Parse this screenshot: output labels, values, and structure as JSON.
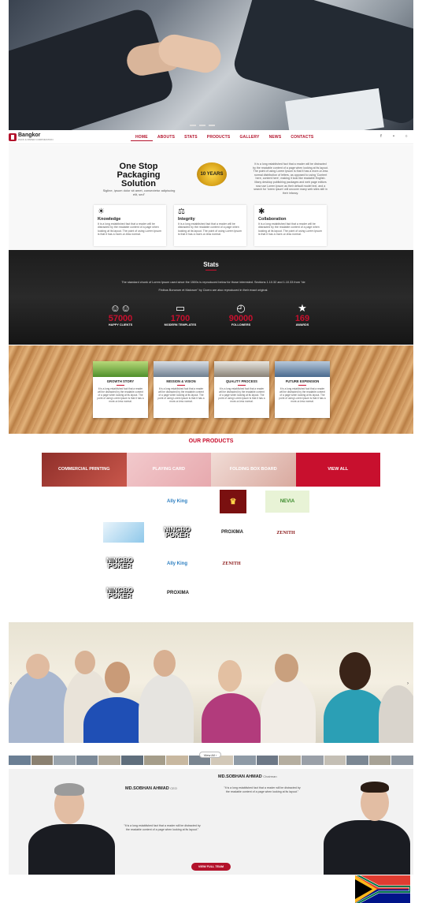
{
  "nav": {
    "brand": "Bangkor",
    "brand_sub": "PACK & PAPER CORPORATION",
    "items": [
      "HOME",
      "ABOUTS",
      "STATS",
      "PRODUCTS",
      "GALLERY",
      "NEWS",
      "CONTACTS"
    ],
    "active": "HOME",
    "social": [
      "facebook-icon",
      "twitter-icon",
      "instagram-icon"
    ]
  },
  "intro": {
    "title": "One Stop Packaging Solution",
    "tagline": "Sigline, ipsum dolor sit amet, consectetur adipiscing elit, sed\"",
    "badge": "10 YEARS",
    "paragraph": "It is a long established fact that a reader will be distracted by the readable content of a page when looking at its layout. The point of using Lorem Ipsum is that it has a more-or-less normal distribution of letters, as opposed to using 'Content here, content here', making it look like readable English. Many desktop publishing packages and web page editors now use Lorem Ipsum as their default model text, and a search for 'lorem ipsum' will uncover many web sites still in their infancy.",
    "features": [
      {
        "icon": "lightbulb-icon",
        "title": "Knowledge",
        "text": "It is a long established fact that a reader will be distracted by the readable content of a page when looking at its layout. The point of using Lorem Ipsum is that it has a more-or-less normal."
      },
      {
        "icon": "handshake-icon",
        "title": "Integrity",
        "text": "It is a long established fact that a reader will be distracted by the readable content of a page when looking at its layout. The point of using Lorem Ipsum is that it has a more-or-less normal."
      },
      {
        "icon": "network-icon",
        "title": "Collaboration",
        "text": "It is a long established fact that a reader will be distracted by the readable content of a page when looking at its layout. The point of using Lorem Ipsum is that it has a more-or-less normal."
      }
    ]
  },
  "stats": {
    "title": "Stats",
    "desc_line1": "The standard chunk of Lorem Ipsum used since the 1500s is reproduced below for those interested. Sections 1.10.32 and 1.10.33 from \"de",
    "desc_line2": "Finibus Bonorum et Malorum\" by Cicero are also reproduced in their exact original.",
    "items": [
      {
        "icon": "users-icon",
        "value": "57000",
        "label": "HAPPY CLIENTS"
      },
      {
        "icon": "monitor-icon",
        "value": "1700",
        "label": "MODERN TEMPLATES"
      },
      {
        "icon": "clock-icon",
        "value": "90000",
        "label": "FOLLOWERS"
      },
      {
        "icon": "award-icon",
        "value": "169",
        "label": "AWARDS"
      }
    ]
  },
  "cards": [
    {
      "title": "GROWTH STORY",
      "text": "It is a long established fact that a reader will be distracted by the readable content of a page when looking at its layout. The point of using Lorem Ipsum is that it has a more-or-less normal."
    },
    {
      "title": "MISSION & VISION",
      "text": "It is a long established fact that a reader will be distracted by the readable content of a page when looking at its layout. The point of using Lorem Ipsum is that it has a more-or-less normal."
    },
    {
      "title": "QUALITY PROCESS",
      "text": "It is a long established fact that a reader will be distracted by the readable content of a page when looking at its layout. The point of using Lorem Ipsum is that it has a more-or-less normal."
    },
    {
      "title": "FUTURE EXPENSION",
      "text": "It is a long established fact that a reader will be distracted by the readable content of a page when looking at its layout. The point of using Lorem Ipsum is that it has a more-or-less normal."
    }
  ],
  "products": {
    "title": "OUR PRODUCTS",
    "strip": [
      "COMMERCIAL PRINTING",
      "PLAYING CARD",
      "FOLDING BOX BOARD",
      "VIEW ALL"
    ],
    "logos": {
      "ally_king": "Ally King",
      "ningbo": "NINGBO POKER",
      "ningbo_sub": "PLAYING CARD BOARD",
      "proxima": "PROXIMA",
      "zenith": "ZENITH",
      "nevia": "NEVIA"
    }
  },
  "gallery": {
    "view_all": "View All ›"
  },
  "leaders": [
    {
      "name": "MD.SOBHAN AHMAD",
      "role": "CEO",
      "quote": "\"It is a long established fact that a reader will be distracted by the readable content of a page when looking at its layout.\""
    },
    {
      "name": "MD.SOBHAN AHMAD",
      "role": "Chairman",
      "quote": "\"It is a long established fact that a reader will be distracted by the readable content of a page when looking at its layout.\""
    }
  ],
  "team_button": "VIEW FULL TEAM",
  "colors": {
    "brand": "#b3122b",
    "accent": "#c8102e"
  }
}
